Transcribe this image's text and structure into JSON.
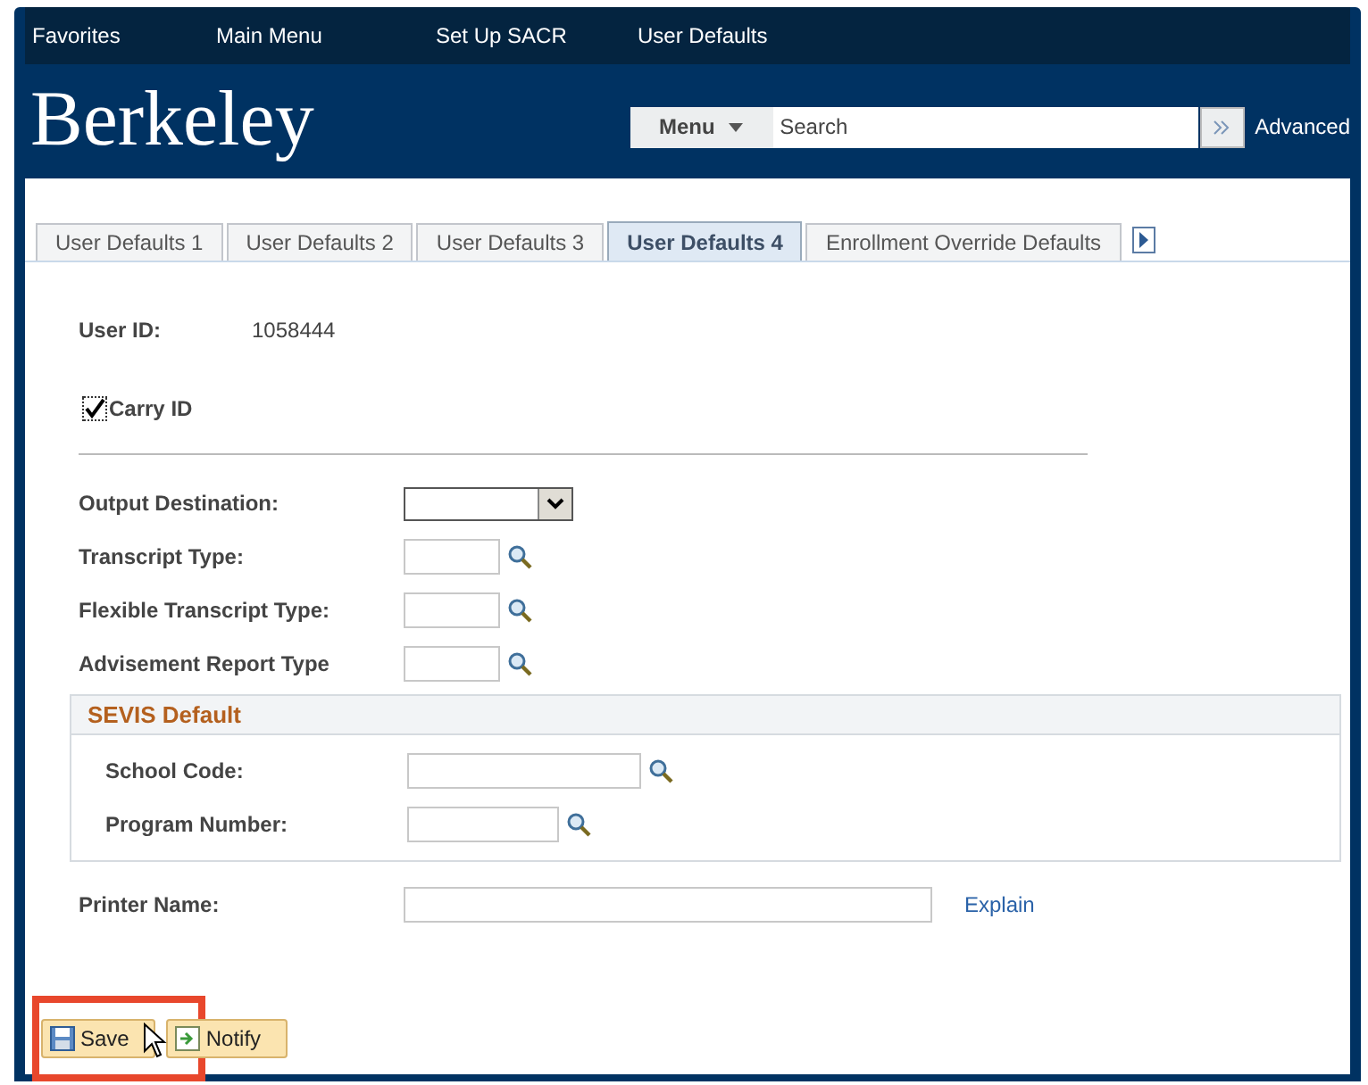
{
  "top_nav": [
    "Favorites",
    "Main Menu",
    "Set Up SACR",
    "User Defaults"
  ],
  "header": {
    "logo": "Berkeley",
    "menu_button": "Menu",
    "search": {
      "placeholder": "Search"
    },
    "advanced_link": "Advanced"
  },
  "tabs": [
    {
      "label": "User Defaults 1",
      "selected": false
    },
    {
      "label": "User Defaults 2",
      "selected": false
    },
    {
      "label": "User Defaults 3",
      "selected": false
    },
    {
      "label": "User Defaults 4",
      "selected": true
    },
    {
      "label": "Enrollment Override Defaults",
      "selected": false
    }
  ],
  "user_id": {
    "label": "User ID:",
    "value": "1058444"
  },
  "carry_id": {
    "label": "Carry ID",
    "checked": true
  },
  "fields": [
    {
      "label": "Output Destination:",
      "kind": "select"
    },
    {
      "label": "Transcript Type:",
      "kind": "lookup"
    },
    {
      "label": "Flexible Transcript Type:",
      "kind": "lookup"
    },
    {
      "label": "Advisement Report Type",
      "kind": "lookup"
    }
  ],
  "sevis": {
    "title": "SEVIS Default",
    "fields": [
      {
        "label": "School Code:",
        "kind": "lookup_wide"
      },
      {
        "label": "Program Number:",
        "kind": "lookup"
      }
    ]
  },
  "printer": {
    "label": "Printer Name:",
    "link": "Explain"
  },
  "buttons": [
    {
      "label": "Save",
      "kind": "save",
      "highlighted": true
    },
    {
      "label": "Notify",
      "kind": "notify",
      "highlighted": false
    }
  ]
}
